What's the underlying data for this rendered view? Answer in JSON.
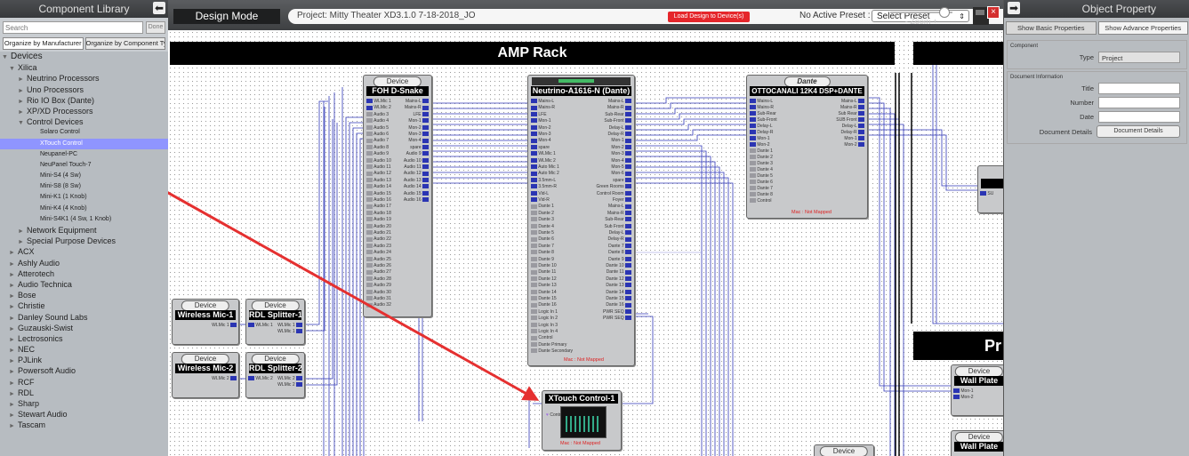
{
  "library": {
    "title": "Component Library",
    "search_placeholder": "Search",
    "done_label": "Done",
    "org_manufacturer": "Organize by Manufacturer",
    "org_type": "Organize by Component Type",
    "tree": [
      {
        "label": "Devices",
        "level": 0,
        "tw": "▼"
      },
      {
        "label": "Xilica",
        "level": 1,
        "tw": "▼"
      },
      {
        "label": "Neutrino Processors",
        "level": 2,
        "tw": "►"
      },
      {
        "label": "Uno Processors",
        "level": 2,
        "tw": "►"
      },
      {
        "label": "Rio IO Box (Dante)",
        "level": 2,
        "tw": "►"
      },
      {
        "label": "XP/XD Processors",
        "level": 2,
        "tw": "►"
      },
      {
        "label": "Control Devices",
        "level": 2,
        "tw": "▼"
      },
      {
        "label": "Solaro Control",
        "level": 3,
        "tw": ""
      },
      {
        "label": "XTouch Control",
        "level": 3,
        "tw": "",
        "selected": true
      },
      {
        "label": "Neupanel-PC",
        "level": 3,
        "tw": ""
      },
      {
        "label": "NeuPanel Touch-7",
        "level": 3,
        "tw": ""
      },
      {
        "label": "Mini-S4 (4 Sw)",
        "level": 3,
        "tw": ""
      },
      {
        "label": "Mini-S8 (8 Sw)",
        "level": 3,
        "tw": ""
      },
      {
        "label": "Mini-K1 (1 Knob)",
        "level": 3,
        "tw": ""
      },
      {
        "label": "Mini-K4 (4 Knob)",
        "level": 3,
        "tw": ""
      },
      {
        "label": "Mini-S4K1 (4 Sw, 1 Knob)",
        "level": 3,
        "tw": ""
      },
      {
        "label": "Network Equipment",
        "level": 2,
        "tw": "►"
      },
      {
        "label": "Special Purpose Devices",
        "level": 2,
        "tw": "►"
      },
      {
        "label": "ACX",
        "level": 1,
        "tw": "►"
      },
      {
        "label": "Ashly Audio",
        "level": 1,
        "tw": "►"
      },
      {
        "label": "Atterotech",
        "level": 1,
        "tw": "►"
      },
      {
        "label": "Audio Technica",
        "level": 1,
        "tw": "►"
      },
      {
        "label": "Bose",
        "level": 1,
        "tw": "►"
      },
      {
        "label": "Christie",
        "level": 1,
        "tw": "►"
      },
      {
        "label": "Danley Sound Labs",
        "level": 1,
        "tw": "►"
      },
      {
        "label": "Guzauski-Swist",
        "level": 1,
        "tw": "►"
      },
      {
        "label": "Lectrosonics",
        "level": 1,
        "tw": "►"
      },
      {
        "label": "NEC",
        "level": 1,
        "tw": "►"
      },
      {
        "label": "PJLink",
        "level": 1,
        "tw": "►"
      },
      {
        "label": "Powersoft Audio",
        "level": 1,
        "tw": "►"
      },
      {
        "label": "RCF",
        "level": 1,
        "tw": "►"
      },
      {
        "label": "RDL",
        "level": 1,
        "tw": "►"
      },
      {
        "label": "Sharp",
        "level": 1,
        "tw": "►"
      },
      {
        "label": "Stewart Audio",
        "level": 1,
        "tw": "►"
      },
      {
        "label": "Tascam",
        "level": 1,
        "tw": "►"
      }
    ]
  },
  "toolbar": {
    "mode": "Design Mode",
    "project": "Project: Mitty Theater XD3.1.0 7-18-2018_JO",
    "load_button": "Load Design to Device(s)",
    "preset_label": "No Active Preset :",
    "preset_value": "Select Preset",
    "zoom_label": "-  Zoom  +",
    "zoom_level": 0.83
  },
  "canvas": {
    "rack_title": "AMP Rack",
    "pro_title": "Pr",
    "device_word": "Device",
    "not_mapped": "Mac : Not Mapped",
    "fohsnake": {
      "name": "FOH D-Snake",
      "left": [
        "WLMic 1",
        "WLMic 2",
        "Audio 3",
        "Audio 4",
        "Audio 5",
        "Audio 6",
        "Audio 7",
        "Audio 8",
        "Audio 9",
        "Audio 10",
        "Audio 11",
        "Audio 12",
        "Audio 13",
        "Audio 14",
        "Audio 15",
        "Audio 16",
        "Audio 17",
        "Audio 18",
        "Audio 19",
        "Audio 20",
        "Audio 21",
        "Audio 22",
        "Audio 23",
        "Audio 24",
        "Audio 25",
        "Audio 26",
        "Audio 27",
        "Audio 28",
        "Audio 29",
        "Audio 30",
        "Audio 31",
        "Audio 32"
      ],
      "right": [
        "Mains-L",
        "Mains-R",
        "LFE",
        "Mon-1",
        "Mon-2",
        "Mon-3",
        "Mon-4",
        "spare",
        "Audio 9",
        "Audio 10",
        "Audio 11",
        "Audio 12",
        "Audio 13",
        "Audio 14",
        "Audio 15",
        "Audio 16"
      ],
      "extra": "Control"
    },
    "neutrino": {
      "name": "Neutrino-A1616-N (Dante)",
      "left": [
        "Mains-L",
        "Mains-R",
        "LFE",
        "Mon-1",
        "Mon-2",
        "Mon-3",
        "Mon-4",
        "spare",
        "WLMic 1",
        "WLMic 2",
        "Auto Mic 1",
        "Auto Mic 2",
        "3.5mm-L",
        "3.5mm-R",
        "Vid-L",
        "Vid-R",
        "Dante 1",
        "Dante 2",
        "Dante 3",
        "Dante 4",
        "Dante 5",
        "Dante 6",
        "Dante 7",
        "Dante 8",
        "Dante 9",
        "Dante 10",
        "Dante 11",
        "Dante 12",
        "Dante 13",
        "Dante 14",
        "Dante 15",
        "Dante 16",
        "Logic In 1",
        "Logic In 2",
        "Logic In 3",
        "Logic In 4",
        "Control",
        "Dante Primary",
        "Dante Secondary"
      ],
      "right": [
        "Mains-L",
        "Mains-R",
        "Sub-Rear",
        "Sub-Front",
        "Delay-L",
        "Delay-R",
        "Mon-1",
        "Mon-2",
        "Mon-3",
        "Mon-4",
        "Mon-5",
        "Mon-6",
        "spare",
        "Green Rooms",
        "Control Room",
        "Foyer",
        "Mains-L",
        "Mains-R",
        "Sub-Rear",
        "Sub Front",
        "Delay-L",
        "Delay-R",
        "Dante 7",
        "Dante 8",
        "Dante 9",
        "Dante 10",
        "Dante 11",
        "Dante 12",
        "Dante 13",
        "Dante 14",
        "Dante 15",
        "Dante 16",
        "PWR SEQ",
        "PWR SEQ"
      ]
    },
    "otto": {
      "name": "OTTOCANALI 12K4 DSP+DANTE",
      "brand": "Dante",
      "left": [
        "Mains-L",
        "Mains-R",
        "Sub-Rear",
        "Sub-Front",
        "Delay-L",
        "Delay-R",
        "Mon-1",
        "Mon-2",
        "Dante 1",
        "Dante 2",
        "Dante 3",
        "Dante 4",
        "Dante 5",
        "Dante 6",
        "Dante 7",
        "Dante 8",
        "Control"
      ],
      "right": [
        "Mains-L",
        "Mains-R",
        "Sub Rear",
        "SUB Front",
        "Delay-L",
        "Delay-R",
        "Mon-1",
        "Mon-2"
      ]
    },
    "wmic1": {
      "name": "Wireless Mic-1",
      "port": "WLMic 1"
    },
    "rdl1": {
      "name": "RDL Splitter-1",
      "left": "WLMic 1",
      "right": [
        "WLMic 1",
        "WLMic 1"
      ]
    },
    "wmic2": {
      "name": "Wireless Mic-2",
      "port": "WLMic 2"
    },
    "rdl2": {
      "name": "RDL Splitter-2",
      "left": "WLMic 2",
      "right": [
        "WLMic 2",
        "WLMic 2"
      ]
    },
    "xtouch": {
      "name": "XTouch Control-1",
      "port": "Control"
    },
    "wallplate1": {
      "name": "Wall Plate",
      "ports": [
        "Mon-1",
        "Mon-2"
      ]
    },
    "wallplate2": {
      "name": "Wall Plate"
    },
    "sub": "SU"
  },
  "props": {
    "title": "Object Property",
    "tab_basic": "Show Basic Properties",
    "tab_advanced": "Show Advance Properties",
    "component_section": "Component",
    "type_label": "Type",
    "type_value": "Project",
    "doc_section": "Document Information",
    "title_label": "Title",
    "number_label": "Number",
    "date_label": "Date",
    "details_label": "Document Details",
    "details_button": "Document Details"
  }
}
